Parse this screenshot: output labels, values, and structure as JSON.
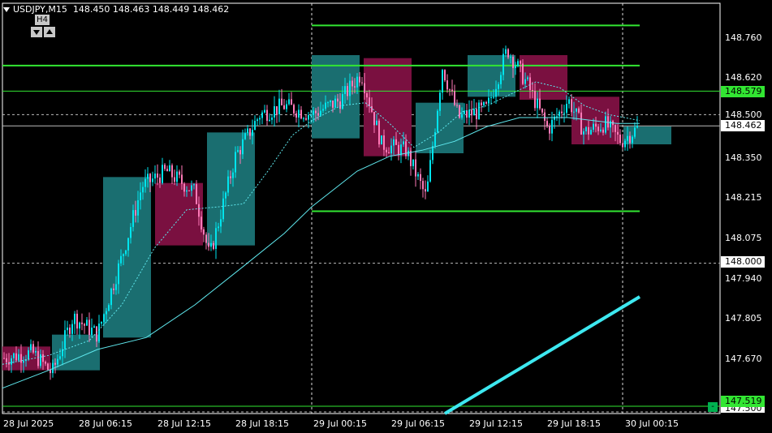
{
  "header": {
    "symbol_tf": "USDJPY,M15",
    "ohlc": "148.450 148.463 148.449 148.462"
  },
  "timeframe_box": {
    "label": "H4"
  },
  "price_axis": {
    "ticks": [
      "148.760",
      "148.620",
      "148.350",
      "148.215",
      "148.075",
      "147.940",
      "147.805",
      "147.670"
    ],
    "tags": {
      "level_high": "148.579",
      "level_mid": "148.500",
      "current": "148.462",
      "round": "148.000",
      "level_low": "147.519",
      "hidden_low": "147.500"
    }
  },
  "time_axis": {
    "ticks": [
      "28 Jul 2025",
      "28 Jul 06:15",
      "28 Jul 12:15",
      "28 Jul 18:15",
      "29 Jul 00:15",
      "29 Jul 06:15",
      "29 Jul 12:15",
      "29 Jul 18:15",
      "30 Jul 00:15"
    ]
  },
  "colors": {
    "bull": "#00e5ee",
    "bear": "#ff7ab8",
    "h4_bull": "#1a6e70",
    "h4_bear": "#7a1040",
    "level_green": "#32e632",
    "ma": "#5fe8ee",
    "grid": "#9a9a9a"
  },
  "chart_data": {
    "type": "candlestick",
    "symbol": "USDJPY",
    "timeframe": "M15",
    "ylim": [
      147.5,
      148.84
    ],
    "last_price": 148.462,
    "levels": [
      148.8,
      148.665,
      148.579,
      148.5,
      148.462,
      148.175,
      148.0,
      147.519
    ],
    "h4_boxes": [
      {
        "o": 147.64,
        "c": 147.72,
        "dir": "bear"
      },
      {
        "o": 147.64,
        "c": 147.76,
        "dir": "bull"
      },
      {
        "o": 147.75,
        "c": 148.29,
        "dir": "bull"
      },
      {
        "o": 148.27,
        "c": 148.06,
        "dir": "bear"
      },
      {
        "o": 148.06,
        "c": 148.44,
        "dir": "bull"
      },
      {
        "o": 148.42,
        "c": 148.7,
        "dir": "bull"
      },
      {
        "o": 148.69,
        "c": 148.36,
        "dir": "bear"
      },
      {
        "o": 148.37,
        "c": 148.54,
        "dir": "bull"
      },
      {
        "o": 148.56,
        "c": 148.7,
        "dir": "bull"
      },
      {
        "o": 148.7,
        "c": 148.55,
        "dir": "bear"
      },
      {
        "o": 148.56,
        "c": 148.4,
        "dir": "bear"
      },
      {
        "o": 148.4,
        "c": 148.46,
        "dir": "bull"
      }
    ]
  }
}
